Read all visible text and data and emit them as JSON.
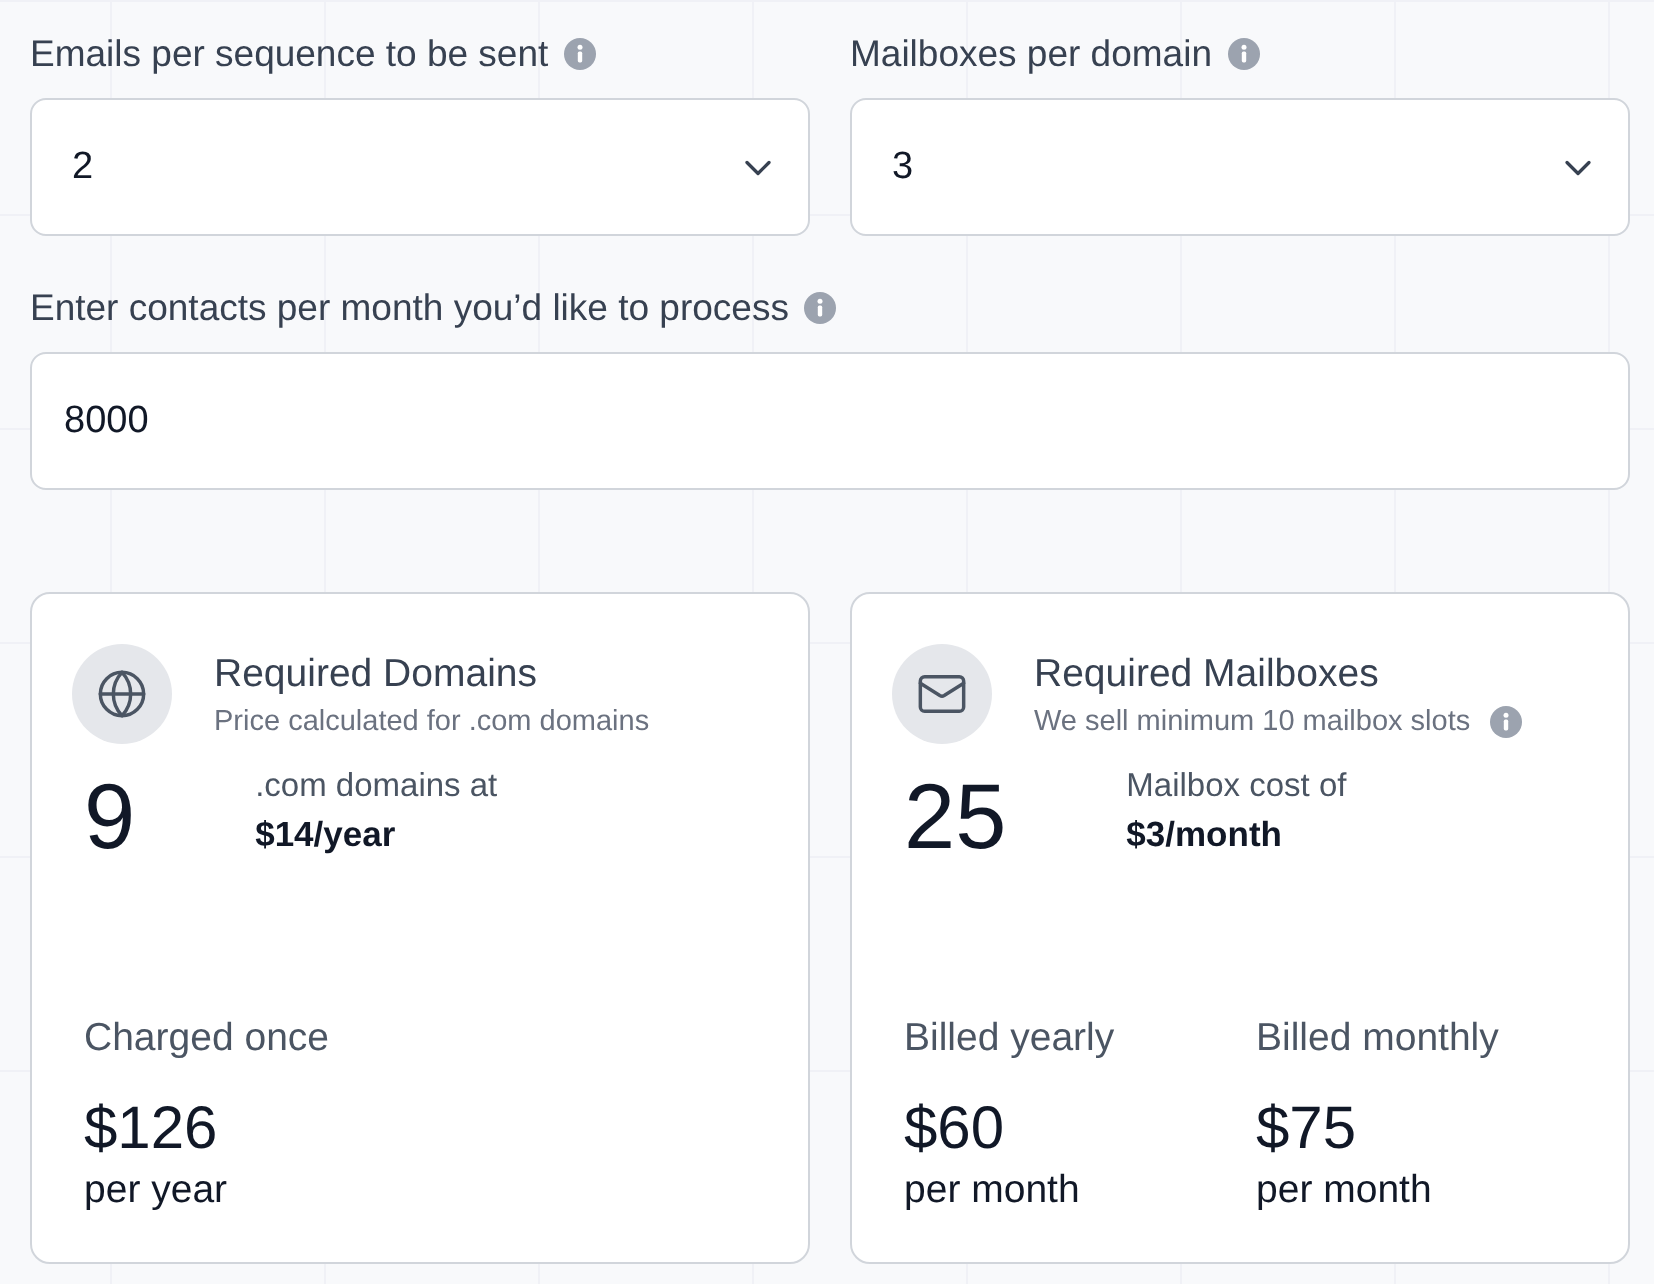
{
  "fields": [
    {
      "kind": "select",
      "label": "Emails per sequence to be sent",
      "info": true,
      "value": "2"
    },
    {
      "kind": "select",
      "label": "Mailboxes per domain",
      "info": true,
      "value": "3"
    },
    {
      "kind": "input",
      "label": "Enter contacts per month you’d like to process",
      "info": true,
      "value": "8000"
    }
  ],
  "cards": [
    {
      "kind": "globe",
      "title": "Required Domains",
      "subtitle": "Price calculated for .com domains",
      "subtitle_info": false,
      "count": "9",
      "rate_label": ".com domains at",
      "rate": "$14/year",
      "prices": [
        {
          "label": "Charged once",
          "amount": "$126",
          "period": "per year"
        }
      ]
    },
    {
      "kind": "mail",
      "title": "Required Mailboxes",
      "subtitle": "We sell minimum 10 mailbox slots",
      "subtitle_info": true,
      "count": "25",
      "rate_label": "Mailbox cost of",
      "rate": "$3/month",
      "prices": [
        {
          "label": "Billed yearly",
          "amount": "$60",
          "period": "per month"
        },
        {
          "label": "Billed monthly",
          "amount": "$75",
          "period": "per month"
        }
      ]
    }
  ]
}
